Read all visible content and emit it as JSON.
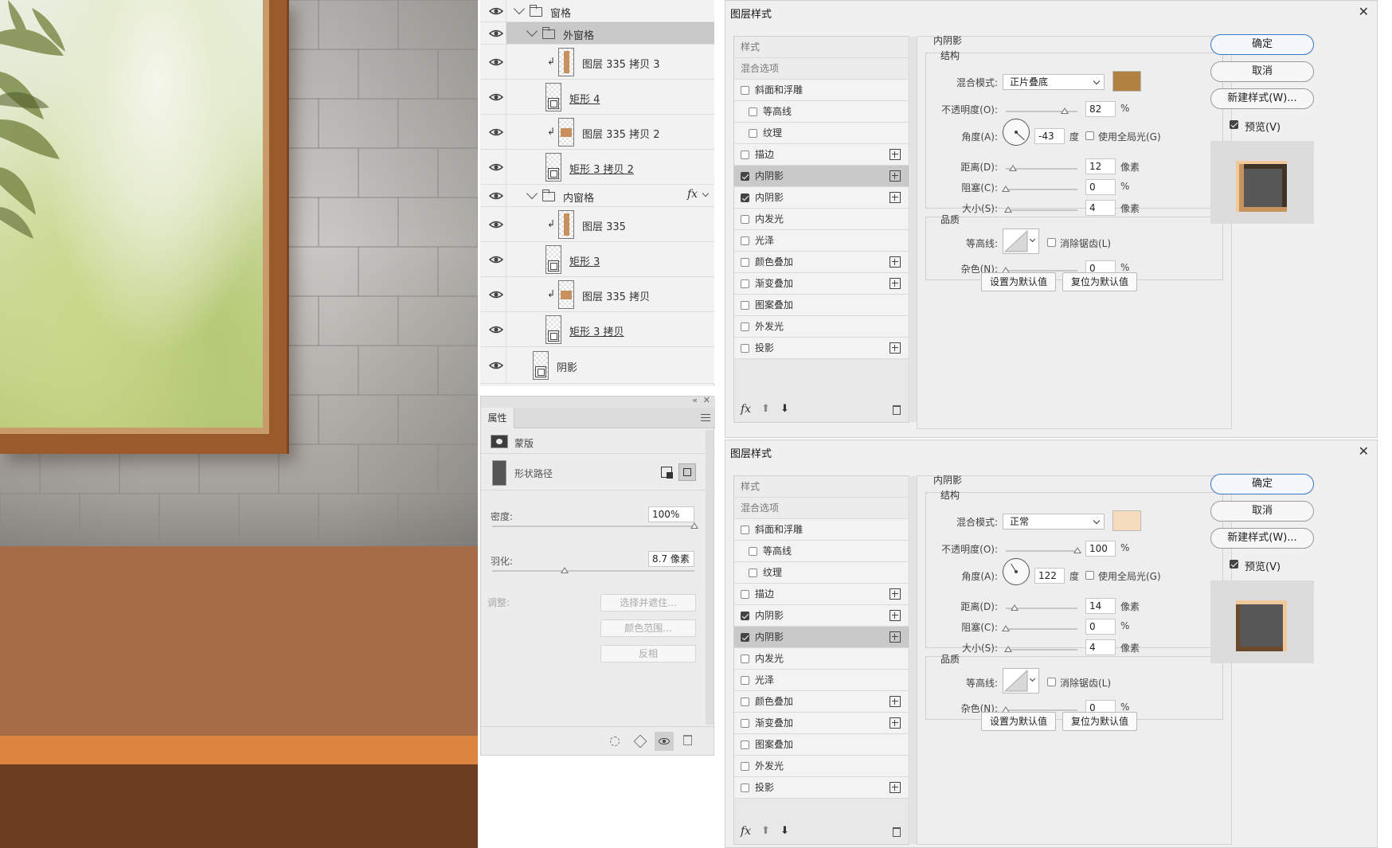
{
  "layers": [
    {
      "name": "窗格",
      "kind": "group",
      "indent": 0,
      "selected": false
    },
    {
      "name": "外窗格",
      "kind": "group",
      "indent": 1,
      "selected": true
    },
    {
      "name": "图层 335 拷贝 3",
      "kind": "clipped-raster",
      "indent": 2,
      "selected": false
    },
    {
      "name": "矩形 4",
      "kind": "shape",
      "indent": 2,
      "selected": false
    },
    {
      "name": "图层 335 拷贝 2",
      "kind": "clipped-raster",
      "indent": 2,
      "selected": false
    },
    {
      "name": "矩形 3 拷贝 2",
      "kind": "shape",
      "indent": 2,
      "selected": false
    },
    {
      "name": "内窗格",
      "kind": "group",
      "indent": 1,
      "selected": false,
      "fx": "fx"
    },
    {
      "name": "图层 335",
      "kind": "clipped-raster",
      "indent": 2,
      "selected": false
    },
    {
      "name": "矩形 3",
      "kind": "shape",
      "indent": 2,
      "selected": false
    },
    {
      "name": "图层 335 拷贝",
      "kind": "clipped-raster",
      "indent": 2,
      "selected": false
    },
    {
      "name": "矩形 3 拷贝",
      "kind": "shape",
      "indent": 2,
      "selected": false
    },
    {
      "name": "阴影",
      "kind": "shape",
      "indent": 1,
      "selected": false
    }
  ],
  "properties": {
    "tab": "属性",
    "mask_label": "蒙版",
    "shape_path_label": "形状路径",
    "density_label": "密度:",
    "density_value": "100%",
    "density_level": 1.0,
    "feather_label": "羽化:",
    "feather_value": "8.7 像素",
    "feather_level": 0.36,
    "adjust_label": "调整:",
    "buttons": [
      "选择并遮住...",
      "颜色范围...",
      "反相"
    ]
  },
  "dialogs": [
    {
      "title": "图层样式",
      "style_list": [
        {
          "label": "样式",
          "head": true
        },
        {
          "label": "混合选项",
          "head": true
        },
        {
          "label": "斜面和浮雕",
          "checked": false,
          "plus": false,
          "sub": false
        },
        {
          "label": "等高线",
          "checked": false,
          "plus": false,
          "sub": true
        },
        {
          "label": "纹理",
          "checked": false,
          "plus": false,
          "sub": true
        },
        {
          "label": "描边",
          "checked": false,
          "plus": true,
          "sub": false
        },
        {
          "label": "内阴影",
          "checked": true,
          "plus": true,
          "sub": false,
          "active": true
        },
        {
          "label": "内阴影",
          "checked": true,
          "plus": true,
          "sub": false
        },
        {
          "label": "内发光",
          "checked": false,
          "plus": false,
          "sub": false
        },
        {
          "label": "光泽",
          "checked": false,
          "plus": false,
          "sub": false
        },
        {
          "label": "颜色叠加",
          "checked": false,
          "plus": true,
          "sub": false
        },
        {
          "label": "渐变叠加",
          "checked": false,
          "plus": true,
          "sub": false
        },
        {
          "label": "图案叠加",
          "checked": false,
          "plus": false,
          "sub": false
        },
        {
          "label": "外发光",
          "checked": false,
          "plus": false,
          "sub": false
        },
        {
          "label": "投影",
          "checked": false,
          "plus": true,
          "sub": false
        }
      ],
      "section_title": "内阴影",
      "structure_title": "结构",
      "blend_mode_label": "混合模式:",
      "blend_mode": "正片叠底",
      "color": "#b08242",
      "opacity_label": "不透明度(O):",
      "opacity": "82",
      "opacity_level": 0.82,
      "angle_label": "角度(A):",
      "angle": "-43",
      "angle_deg": -43,
      "degree_unit": "度",
      "global_light_label": "使用全局光(G)",
      "distance_label": "距离(D):",
      "distance": "12",
      "distance_level": 0.1,
      "choke_label": "阻塞(C):",
      "choke": "0",
      "choke_level": 0,
      "size_label": "大小(S):",
      "size": "4",
      "size_level": 0.03,
      "px_unit": "像素",
      "pct_unit": "%",
      "quality_title": "品质",
      "contour_label": "等高线:",
      "antialias_label": "消除锯齿(L)",
      "noise_label": "杂色(N):",
      "noise": "0",
      "noise_level": 0,
      "default_set": "设置为默认值",
      "default_reset": "复位为默认值",
      "ok": "确定",
      "cancel": "取消",
      "new_style": "新建样式(W)...",
      "preview": "预览(V)",
      "preview_color": "#f1c89a",
      "preview_color2": "#c99360"
    },
    {
      "title": "图层样式",
      "style_list": [
        {
          "label": "样式",
          "head": true
        },
        {
          "label": "混合选项",
          "head": true
        },
        {
          "label": "斜面和浮雕",
          "checked": false,
          "plus": false,
          "sub": false
        },
        {
          "label": "等高线",
          "checked": false,
          "plus": false,
          "sub": true
        },
        {
          "label": "纹理",
          "checked": false,
          "plus": false,
          "sub": true
        },
        {
          "label": "描边",
          "checked": false,
          "plus": true,
          "sub": false
        },
        {
          "label": "内阴影",
          "checked": true,
          "plus": true,
          "sub": false
        },
        {
          "label": "内阴影",
          "checked": true,
          "plus": true,
          "sub": false,
          "active": true
        },
        {
          "label": "内发光",
          "checked": false,
          "plus": false,
          "sub": false
        },
        {
          "label": "光泽",
          "checked": false,
          "plus": false,
          "sub": false
        },
        {
          "label": "颜色叠加",
          "checked": false,
          "plus": true,
          "sub": false
        },
        {
          "label": "渐变叠加",
          "checked": false,
          "plus": true,
          "sub": false
        },
        {
          "label": "图案叠加",
          "checked": false,
          "plus": false,
          "sub": false
        },
        {
          "label": "外发光",
          "checked": false,
          "plus": false,
          "sub": false
        },
        {
          "label": "投影",
          "checked": false,
          "plus": true,
          "sub": false
        }
      ],
      "section_title": "内阴影",
      "structure_title": "结构",
      "blend_mode_label": "混合模式:",
      "blend_mode": "正常",
      "color": "#f5dcbc",
      "opacity_label": "不透明度(O):",
      "opacity": "100",
      "opacity_level": 1.0,
      "angle_label": "角度(A):",
      "angle": "122",
      "angle_deg": 122,
      "degree_unit": "度",
      "global_light_label": "使用全局光(G)",
      "distance_label": "距离(D):",
      "distance": "14",
      "distance_level": 0.12,
      "choke_label": "阻塞(C):",
      "choke": "0",
      "choke_level": 0,
      "size_label": "大小(S):",
      "size": "4",
      "size_level": 0.03,
      "px_unit": "像素",
      "pct_unit": "%",
      "quality_title": "品质",
      "contour_label": "等高线:",
      "antialias_label": "消除锯齿(L)",
      "noise_label": "杂色(N):",
      "noise": "0",
      "noise_level": 0,
      "default_set": "设置为默认值",
      "default_reset": "复位为默认值",
      "ok": "确定",
      "cancel": "取消",
      "new_style": "新建样式(W)...",
      "preview": "预览(V)",
      "preview_color": "#f1c89a",
      "preview_color2": "#c99360"
    }
  ],
  "colors": {
    "wall_tile": "#bdbab7",
    "counter_top": "#a56d45",
    "counter_edge": "#dc853f",
    "counter_front": "#6b3c1f",
    "window_frame": "#9a5a2a",
    "accent_button_border": "#3b74c6"
  },
  "icons": {
    "visibility": "eye-icon",
    "group": "folder-icon",
    "clip": "clipping-arrow-icon",
    "delete": "trash-icon",
    "fx": "fx-icon"
  }
}
